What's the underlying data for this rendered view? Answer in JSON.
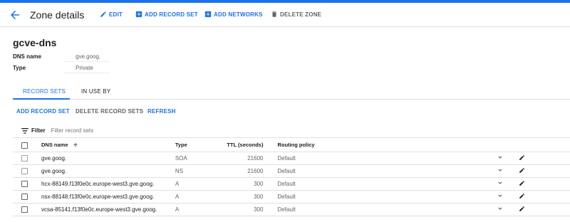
{
  "header": {
    "title": "Zone details",
    "edit_label": "EDIT",
    "add_record_set_label": "ADD RECORD SET",
    "add_networks_label": "ADD NETWORKS",
    "delete_zone_label": "DELETE ZONE"
  },
  "zone": {
    "name": "gcve-dns",
    "fields": [
      {
        "key": "DNS name",
        "value": "gve.goog."
      },
      {
        "key": "Type",
        "value": "Private"
      }
    ]
  },
  "tabs": [
    {
      "label": "RECORD SETS",
      "active": true
    },
    {
      "label": "IN USE BY",
      "active": false
    }
  ],
  "actions": {
    "add_record_set": "ADD RECORD SET",
    "delete_record_sets": "DELETE RECORD SETS",
    "refresh": "REFRESH"
  },
  "filter": {
    "label": "Filter",
    "placeholder": "Filter record sets"
  },
  "table": {
    "columns": [
      "DNS name",
      "Type",
      "TTL (seconds)",
      "Routing policy"
    ],
    "rows": [
      {
        "name": "gve.goog.",
        "type": "SOA",
        "ttl": "21600",
        "policy": "Default",
        "selectable": false
      },
      {
        "name": "gve.goog.",
        "type": "NS",
        "ttl": "21600",
        "policy": "Default",
        "selectable": false
      },
      {
        "name": "hcx-88149.f13f0e0c.europe-west3.gve.goog.",
        "type": "A",
        "ttl": "300",
        "policy": "Default",
        "selectable": true
      },
      {
        "name": "nsx-88148.f13f0e0c.europe-west3.gve.goog.",
        "type": "A",
        "ttl": "300",
        "policy": "Default",
        "selectable": true
      },
      {
        "name": "vcsa-85141.f13f0e0c.europe-west3.gve.goog.",
        "type": "A",
        "ttl": "300",
        "policy": "Default",
        "selectable": true
      }
    ]
  },
  "colors": {
    "accent": "#1a73e8",
    "text": "#202124",
    "secondary": "#5f6368",
    "divider": "#e0e0e0"
  },
  "icons": {
    "back": "arrow-left-icon",
    "edit": "pencil-icon",
    "add": "plus-box-icon",
    "delete": "trash-icon",
    "filter": "filter-lines-icon",
    "sort": "arrow-up-icon",
    "expand": "chevron-down-icon"
  }
}
